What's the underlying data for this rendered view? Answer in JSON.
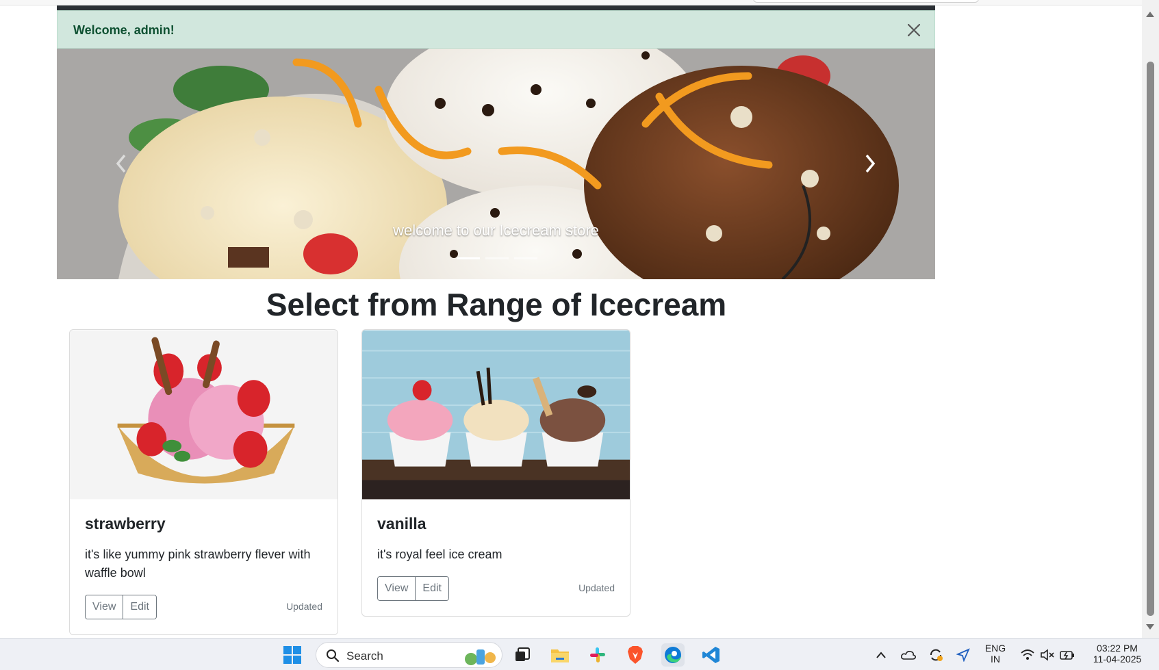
{
  "alert": {
    "message": "Welcome, admin!"
  },
  "carousel": {
    "caption": "welcome to our Icecream store",
    "indicator_count": 3,
    "active_indicator": 1
  },
  "section": {
    "title": "Select from Range of Icecream"
  },
  "cards": [
    {
      "title": "strawberry",
      "text": "it's like yummy pink strawberry flever with waffle bowl",
      "view_label": "View",
      "edit_label": "Edit",
      "status": "Updated"
    },
    {
      "title": "vanilla",
      "text": "it's royal feel ice cream",
      "view_label": "View",
      "edit_label": "Edit",
      "status": "Updated"
    }
  ],
  "taskbar": {
    "search_placeholder": "Search",
    "language_line1": "ENG",
    "language_line2": "IN",
    "time": "03:22 PM",
    "date": "11-04-2025",
    "pinned_icons": [
      "task-view-icon",
      "file-explorer-icon",
      "slack-icon",
      "brave-icon",
      "edge-icon",
      "vscode-icon"
    ]
  },
  "colors": {
    "alert_bg": "#d1e7dd",
    "alert_text": "#0f5132",
    "navbar": "#2b3035",
    "button_border": "#6c757d"
  }
}
